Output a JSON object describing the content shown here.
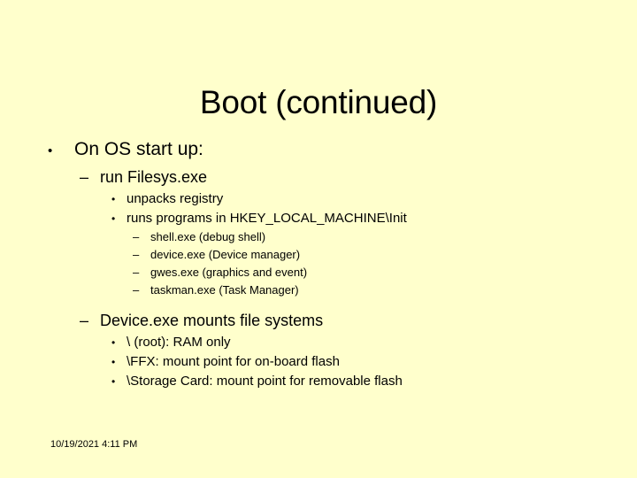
{
  "slide": {
    "title": "Boot (continued)",
    "background_color": "#ffffcc",
    "text_color": "#000000",
    "footer_date": "10/19/2021 4:11 PM",
    "markers": {
      "level1_bullet": "•",
      "level2_dash": "–",
      "level3_bullet": "•",
      "level4_dash": "–"
    },
    "outline": {
      "l1_on_os_start_up": "On OS start up:",
      "l2_run_filesys": "run Filesys.exe",
      "l3_unpacks_registry": "unpacks registry",
      "l3_runs_programs": "runs programs in HKEY_LOCAL_MACHINE\\Init",
      "l4_shell_exe": "shell.exe (debug shell)",
      "l4_device_exe": "device.exe (Device manager)",
      "l4_gwes_exe": "gwes.exe (graphics and event)",
      "l4_taskman_exe": "taskman.exe (Task Manager)",
      "l2_device_mounts": "Device.exe mounts file systems",
      "l3_root": "\\ (root):  RAM only",
      "l3_ffx": "\\FFX:  mount point for on-board flash",
      "l3_storage_card": "\\Storage Card:  mount point for removable flash"
    }
  }
}
